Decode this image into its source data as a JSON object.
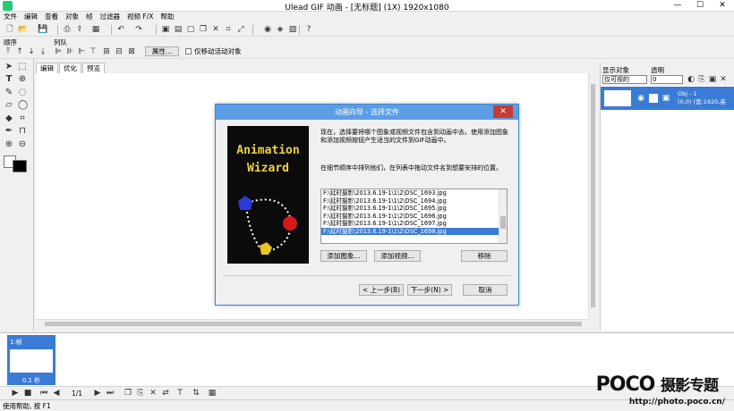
{
  "app": {
    "title": "Ulead GIF 动画 - [无标题] (1X) 1920x1080",
    "minimize": "—",
    "maximize": "☐",
    "close": "✕"
  },
  "menu": [
    "文件",
    "编辑",
    "查看",
    "对象",
    "帧",
    "过滤器",
    "视频 F/X",
    "帮助"
  ],
  "toolbar2": {
    "order_label": "顺序",
    "arrange_label": "列队",
    "properties_button": "属性...",
    "move_active_only": "仅移动活动对象"
  },
  "tabs": [
    "编辑",
    "优化",
    "预览"
  ],
  "right_panel": {
    "display_objects_label": "显示对象",
    "transparency_label": "透明",
    "display_select_value": "仅可视的",
    "transparency_value": "0",
    "object_name": "Obj - 1",
    "object_info": "(0,0) (宽:1920,高"
  },
  "frame": {
    "label": "1:帧",
    "delay": "0.1 秒"
  },
  "playbar": {
    "counter": "1/1"
  },
  "status": "使用帮助, 按 F1",
  "dialog": {
    "title": "动画向导 - 选择文件",
    "intro": "现在，选择要将哪个图象或视频文件包含到动画中去。使用添加图象和添加视频按钮产生适当的文件到GIF动画中。",
    "hint": "在细节顺序中排列他们，在列表中拖动文件名到想要安排的位置。",
    "wizard_line1": "Animation",
    "wizard_line2": "Wizard",
    "files": [
      "F:\\延时摄影\\2013.6.19-1\\1\\2\\DSC_1693.jpg",
      "F:\\延时摄影\\2013.6.19-1\\1\\2\\DSC_1694.jpg",
      "F:\\延时摄影\\2013.6.19-1\\1\\2\\DSC_1695.jpg",
      "F:\\延时摄影\\2013.6.19-1\\1\\2\\DSC_1696.jpg",
      "F:\\延时摄影\\2013.6.19-1\\1\\2\\DSC_1697.jpg",
      "F:\\延时摄影\\2013.6.19-1\\1\\2\\DSC_1698.jpg"
    ],
    "selected_index": 5,
    "add_image": "添加图象...",
    "add_video": "添加视频...",
    "remove": "移除",
    "back": "< 上一步(B)",
    "next": "下一步(N) >",
    "cancel": "取消"
  },
  "watermark": {
    "brand": "POCO",
    "tagline": "摄影专题",
    "url": "http://photo.poco.cn/"
  },
  "colors": {
    "accent": "#3a7bd5",
    "dialog_title": "#5c9ee6",
    "close_red": "#c43c30",
    "wizard_text": "#f0d23c"
  }
}
